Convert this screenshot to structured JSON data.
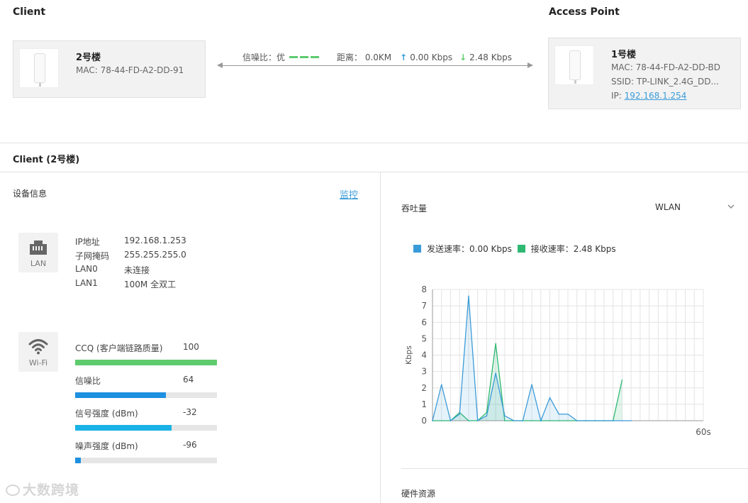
{
  "header": {
    "client_title": "Client",
    "ap_title": "Access Point"
  },
  "client_device": {
    "name": "2号楼",
    "mac": "MAC: 78-44-FD-A2-DD-91"
  },
  "ap_device": {
    "name": "1号楼",
    "mac": "MAC: 78-44-FD-A2-DD-BD",
    "ssid": "SSID: TP-LINK_2.4G_DD...",
    "ip_label": "IP: ",
    "ip": "192.168.1.254"
  },
  "link": {
    "snr_label": "信噪比：优",
    "distance": "距离：  0.0KM",
    "up_rate": "0.00 Kbps",
    "down_rate": "2.48 Kbps"
  },
  "section": {
    "title": "Client (2号楼)"
  },
  "device_info": {
    "title": "设备信息",
    "monitor": "监控",
    "lan_icon_caption": "LAN",
    "wifi_icon_caption": "Wi-Fi",
    "lan": [
      {
        "key": "IP地址",
        "value": "192.168.1.253"
      },
      {
        "key": "子网掩码",
        "value": "255.255.255.0"
      },
      {
        "key": "LAN0",
        "value": "未连接"
      },
      {
        "key": "LAN1",
        "value": "100M 全双工"
      }
    ],
    "wifi": [
      {
        "label": "CCQ (客户端链路质量)",
        "value": "100",
        "fraction": 1.0,
        "color": "#5ecb6e"
      },
      {
        "label": "信噪比",
        "value": "64",
        "fraction": 0.64,
        "color": "#1e90e0"
      },
      {
        "label": "信号强度 (dBm)",
        "value": "-32",
        "fraction": 0.68,
        "color": "#1ab2e6"
      },
      {
        "label": "噪声强度 (dBm)",
        "value": "-96",
        "fraction": 0.04,
        "color": "#1e90e0"
      }
    ]
  },
  "throughput": {
    "title": "吞吐量",
    "interface_select": "WLAN",
    "legend_send": "发送速率：0.00 Kbps",
    "legend_recv": "接收速率：2.48 Kbps",
    "send_color": "#3a9bd9",
    "recv_color": "#2eb872"
  },
  "hardware": {
    "title": "硬件资源"
  },
  "watermark": "大数跨境",
  "chart_data": {
    "type": "line",
    "title": "",
    "xlabel": "",
    "ylabel": "Kbps",
    "x_tick_label": "60s",
    "ylim": [
      0,
      8
    ],
    "yticks": [
      "0",
      "1",
      "2",
      "3",
      "4",
      "5",
      "6",
      "7",
      "8"
    ],
    "x": [
      0,
      1,
      2,
      3,
      4,
      5,
      6,
      7,
      8,
      9,
      10,
      11,
      12,
      13,
      14,
      15,
      16,
      17,
      18,
      19,
      20,
      21,
      22,
      23,
      24,
      25,
      26,
      27,
      28,
      29,
      30
    ],
    "series": [
      {
        "name": "发送速率",
        "color": "#3a9bd9",
        "values": [
          0,
          2.2,
          0,
          0.4,
          7.6,
          0,
          0.3,
          2.9,
          0.3,
          0,
          0,
          2.2,
          0,
          1.4,
          0.4,
          0.4,
          0,
          0,
          0,
          0,
          0,
          0,
          0,
          null,
          null,
          null,
          null,
          null,
          null,
          null,
          null
        ]
      },
      {
        "name": "接收速率",
        "color": "#2eb872",
        "values": [
          0,
          0,
          0,
          0.5,
          0,
          0,
          0.5,
          4.7,
          0,
          0,
          0,
          0,
          0,
          0,
          0,
          0,
          0,
          0,
          0,
          0,
          0,
          2.48,
          null,
          null,
          null,
          null,
          null,
          null,
          null,
          null,
          null
        ]
      }
    ]
  }
}
